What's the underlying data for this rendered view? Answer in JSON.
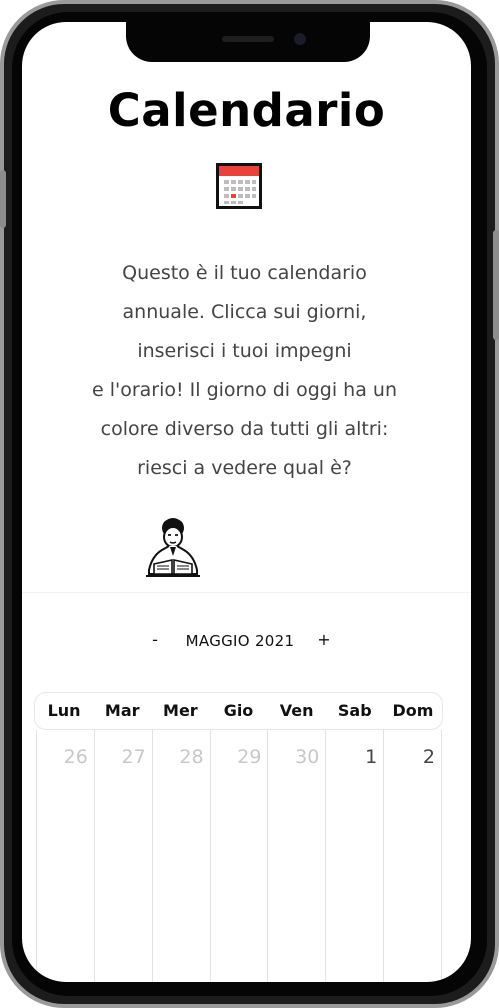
{
  "page": {
    "title": "Calendario",
    "intro_lines": [
      "Questo è il tuo calendario",
      "annuale. Clicca sui giorni,",
      "inserisci i tuoi impegni",
      "e l'orario! Il giorno di oggi ha un",
      "colore diverso da tutti gli altri:",
      "riesci a vedere qual è?"
    ]
  },
  "icons": {
    "calendar": "calendar-icon",
    "illustration": "person-reading-illustration"
  },
  "calendar": {
    "prev_label": "-",
    "month_label": "MAGGIO 2021",
    "next_label": "+",
    "weekdays": [
      "Lun",
      "Mar",
      "Mer",
      "Gio",
      "Ven",
      "Sab",
      "Dom"
    ],
    "days": [
      "26",
      "27",
      "28",
      "29",
      "30",
      "1",
      "2"
    ]
  },
  "colors": {
    "accent_red": "#e8423b",
    "text_dark": "#111111",
    "text_muted": "#c8c8c8"
  }
}
